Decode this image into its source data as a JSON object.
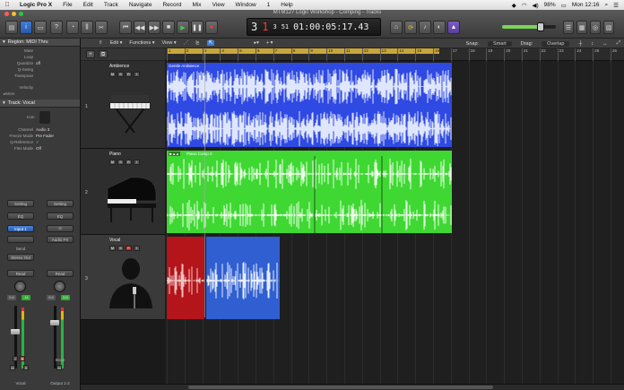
{
  "menubar": {
    "apple": "",
    "items": [
      "Logic Pro X",
      "File",
      "Edit",
      "Track",
      "Navigate",
      "Record",
      "Mix",
      "View",
      "Window",
      "1",
      "Help"
    ],
    "battery": "98%",
    "clock": "Mon 12:16"
  },
  "window": {
    "title": "MTM127 Logic Workshop - Comping - Tracks"
  },
  "lcd": {
    "bar": "3",
    "beat": "1",
    "sub": "3",
    "tick": "51",
    "time": "01:00:05:17.43"
  },
  "master_volume": {
    "level": 0.72
  },
  "tracks_toolbar": {
    "edit": "Edit",
    "functions": "Functions",
    "view": "View",
    "snap_label": "Snap:",
    "snap_value": "Smart",
    "drag_label": "Drag:",
    "drag_value": "Overlap"
  },
  "inspector": {
    "region_header": "Region: MIDI Thru",
    "region_rows": [
      {
        "k": "Mute",
        "v": ""
      },
      {
        "k": "Loop",
        "v": ""
      },
      {
        "k": "Quantize",
        "v": "off"
      },
      {
        "k": "Q-Swing",
        "v": ""
      },
      {
        "k": "Transpose",
        "v": ""
      },
      {
        "k": "Velocity",
        "v": ""
      }
    ],
    "more": "More",
    "track_header": "Track: Vocal",
    "icon_label": "Icon",
    "track_rows": [
      {
        "k": "Channel",
        "v": "Audio 3"
      },
      {
        "k": "Freeze Mode",
        "v": "Pre Fader"
      },
      {
        "k": "Q-Reference",
        "v": "✓"
      },
      {
        "k": "Flex Mode",
        "v": "Off"
      }
    ],
    "strip_left": {
      "setting": "Setting",
      "eq": "EQ",
      "input": "Input 1",
      "send": "Send",
      "output": "Stereo Out",
      "automation": "Read",
      "pan_value": "0.0",
      "peak_value": "-11",
      "name": "Vocal"
    },
    "strip_right": {
      "setting": "Setting",
      "eq": "EQ",
      "input": "Audio FX",
      "automation": "Read",
      "pan_value": "0.0",
      "peak_value": "0.0",
      "bounce": "Bnce",
      "name": "Output 1-2"
    }
  },
  "ruler": {
    "bars": [
      "1",
      "2",
      "3",
      "4",
      "5",
      "6",
      "7",
      "8",
      "9",
      "10",
      "11",
      "12",
      "13",
      "14",
      "15",
      "16",
      "17",
      "18",
      "19",
      "20",
      "21",
      "22",
      "23",
      "24",
      "25",
      "26"
    ]
  },
  "tracks": [
    {
      "number": "1",
      "name": "Ambience",
      "kind": "keyboard"
    },
    {
      "number": "2",
      "name": "Piano",
      "kind": "grand-piano"
    },
    {
      "number": "3",
      "name": "Vocal",
      "kind": "vocalist"
    }
  ],
  "regions": [
    {
      "name": "Gentle Ambience",
      "color": "#2f49e3",
      "track": 0
    },
    {
      "name": "Piano Comp 2",
      "color": "#3fd833",
      "track": 1
    },
    {
      "name": "",
      "color": "#b3151a",
      "track": 2
    },
    {
      "name": "",
      "color": "#2f5fd0",
      "track": 2
    }
  ]
}
